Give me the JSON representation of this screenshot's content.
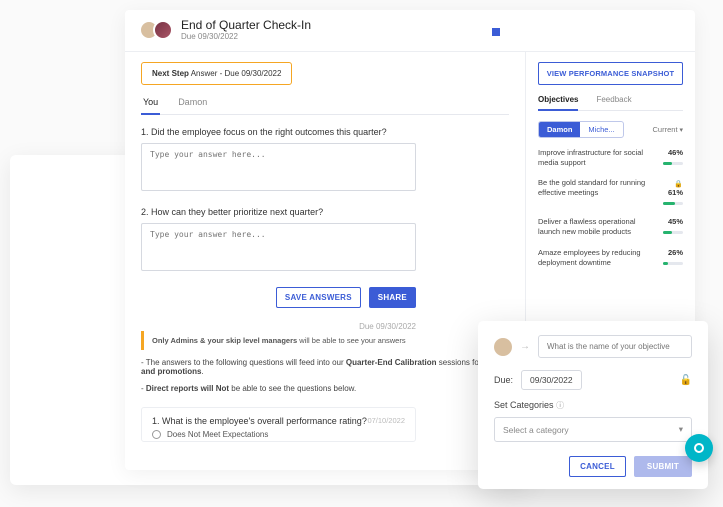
{
  "header": {
    "title": "End of Quarter Check-In",
    "due_label": "Due 09/30/2022"
  },
  "next_step": {
    "label": "Next Step",
    "text": "Answer - Due 09/30/2022"
  },
  "tabs": {
    "you": "You",
    "damon": "Damon"
  },
  "questions": {
    "q1": "1. Did the employee focus on the right outcomes this quarter?",
    "q2": "2. How can they better prioritize next quarter?",
    "placeholder": "Type your answer here..."
  },
  "buttons": {
    "save": "SAVE ANSWERS",
    "share": "SHARE"
  },
  "admin_note": {
    "bold": "Only Admins & your skip level managers",
    "rest": " will be able to see your answers",
    "due": "Due 09/30/2022"
  },
  "notes": {
    "line1_a": "- The answers to the following questions will feed into our ",
    "line1_b": "Quarter-End Calibration",
    "line1_c": " sessions for ",
    "line1_d": "pay and promotions",
    "line1_e": ".",
    "line2_a": "- ",
    "line2_b": "Direct reports will Not",
    "line2_c": " be able to see the questions below."
  },
  "rating": {
    "question": "1. What is the employee's overall performance rating?",
    "date": "07/10/2022",
    "opt1": "Does Not Meet Expectations"
  },
  "sidebar": {
    "snapshot": "VIEW PERFORMANCE SNAPSHOT",
    "tabs": {
      "objectives": "Objectives",
      "feedback": "Feedback"
    },
    "chips": {
      "damon": "Damon",
      "miche": "Miche..."
    },
    "current": "Current",
    "objectives": [
      {
        "text": "Improve infrastructure for social media support",
        "pct": "46%",
        "w": 46,
        "lock": false
      },
      {
        "text": "Be the gold standard for running effective meetings",
        "pct": "61%",
        "w": 61,
        "lock": true
      },
      {
        "text": "Deliver a flawless operational launch new mobile products",
        "pct": "45%",
        "w": 45,
        "lock": false
      },
      {
        "text": "Amaze employees by reducing deployment downtime",
        "pct": "26%",
        "w": 26,
        "lock": false
      }
    ]
  },
  "popover": {
    "obj_placeholder": "What is the name of your objective",
    "due_label": "Due:",
    "due_value": "09/30/2022",
    "set_cat": "Set Categories",
    "select_placeholder": "Select a category",
    "cancel": "CANCEL",
    "submit": "SUBMIT"
  }
}
